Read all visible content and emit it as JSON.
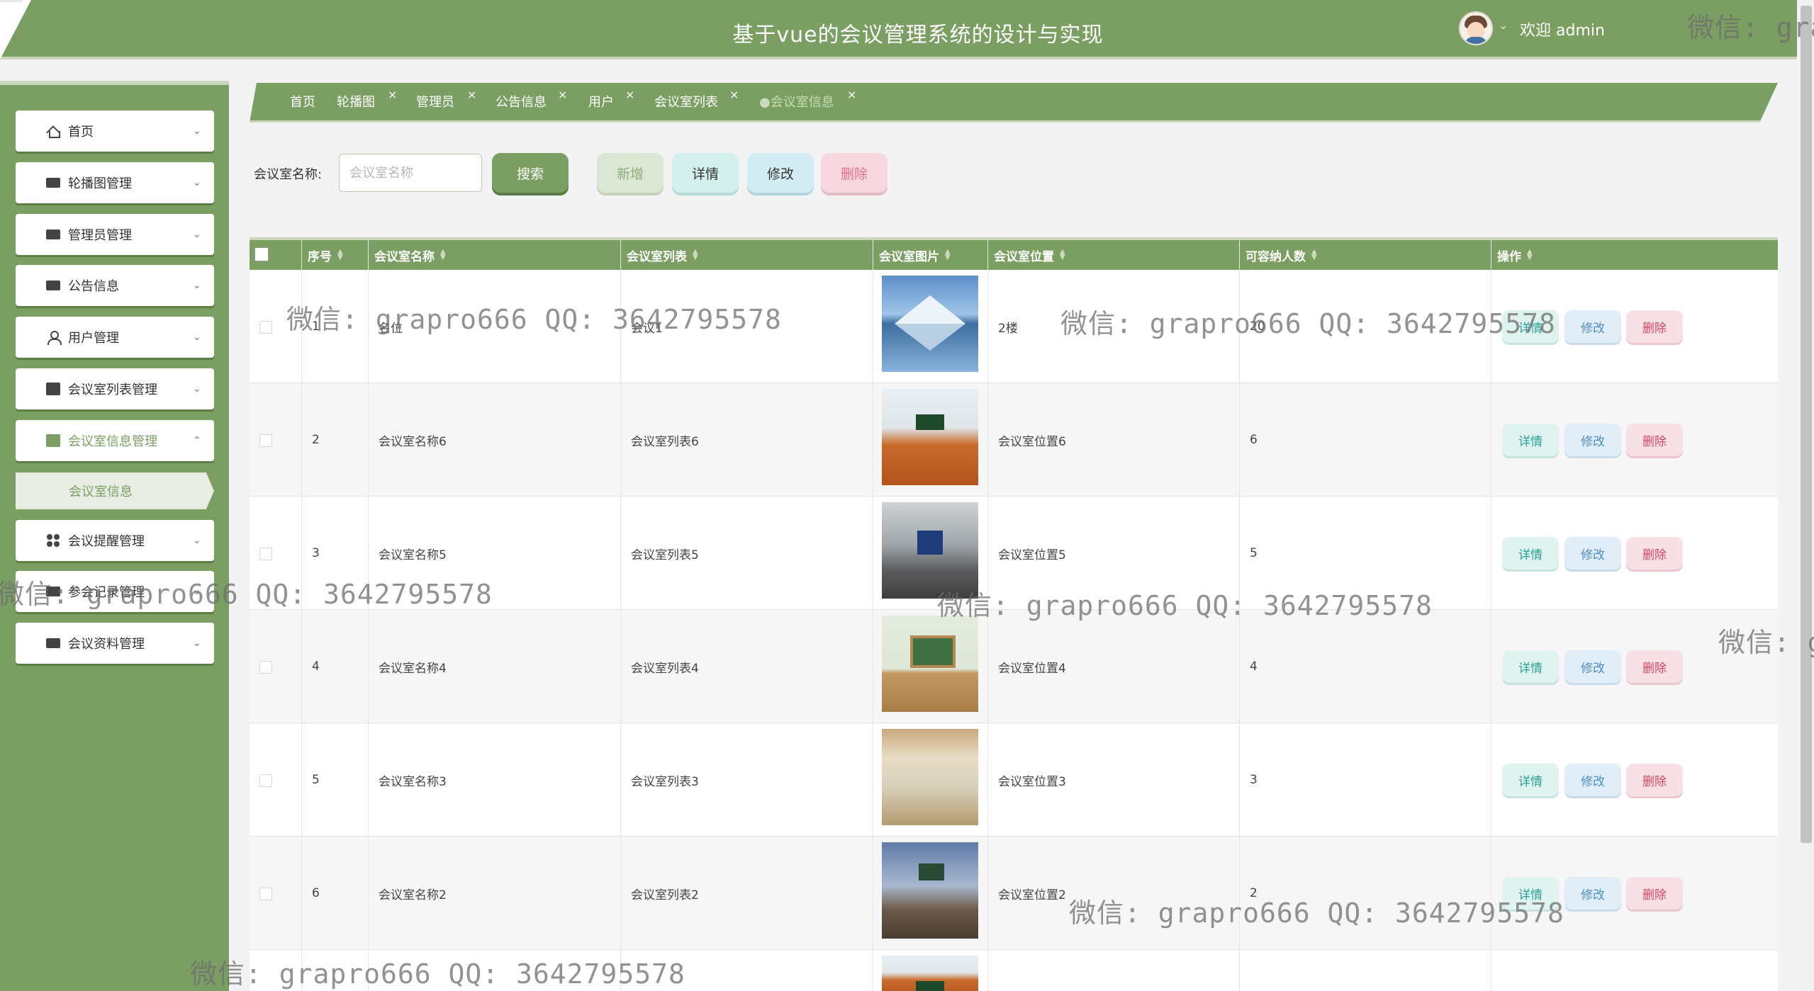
{
  "header": {
    "title": "基于vue的会议管理系统的设计与实现",
    "welcome": "欢迎 admin"
  },
  "sidebar": {
    "items": [
      {
        "label": "首页",
        "icon": "home-icon"
      },
      {
        "label": "轮播图管理",
        "icon": "briefcase-icon"
      },
      {
        "label": "管理员管理",
        "icon": "briefcase-icon"
      },
      {
        "label": "公告信息",
        "icon": "folder-icon"
      },
      {
        "label": "用户管理",
        "icon": "user-icon"
      },
      {
        "label": "会议室列表管理",
        "icon": "box-icon"
      },
      {
        "label": "会议室信息管理",
        "icon": "box-icon"
      },
      {
        "label": "会议提醒管理",
        "icon": "grid-icon"
      },
      {
        "label": "参会记录管理",
        "icon": "folder-icon"
      },
      {
        "label": "会议资料管理",
        "icon": "wallet-icon"
      }
    ],
    "submenu_active": "会议室信息"
  },
  "tabs": [
    {
      "label": "首页",
      "closable": false
    },
    {
      "label": "轮播图",
      "closable": true
    },
    {
      "label": "管理员",
      "closable": true
    },
    {
      "label": "公告信息",
      "closable": true
    },
    {
      "label": "用户",
      "closable": true
    },
    {
      "label": "会议室列表",
      "closable": true
    },
    {
      "label": "●会议室信息",
      "closable": true,
      "active": true
    }
  ],
  "filter": {
    "label": "会议室名称:",
    "placeholder": "会议室名称",
    "search": "搜索",
    "add": "新增",
    "detail": "详情",
    "edit": "修改",
    "delete": "删除"
  },
  "table": {
    "columns": [
      "序号",
      "会议室名称",
      "会议室列表",
      "会议室图片",
      "会议室位置",
      "可容纳人数",
      "操作"
    ],
    "rows": [
      {
        "index": "1",
        "name": "名位",
        "list": "会议1",
        "location": "2楼",
        "capacity": "20",
        "image": "mountain-lake"
      },
      {
        "index": "2",
        "name": "会议室名称6",
        "list": "会议室列表6",
        "location": "会议室位置6",
        "capacity": "6",
        "image": "classroom-orange-seats"
      },
      {
        "index": "3",
        "name": "会议室名称5",
        "list": "会议室列表5",
        "location": "会议室位置5",
        "capacity": "5",
        "image": "classroom-screen"
      },
      {
        "index": "4",
        "name": "会议室名称4",
        "list": "会议室列表4",
        "location": "会议室位置4",
        "capacity": "4",
        "image": "classroom-chalkboard"
      },
      {
        "index": "5",
        "name": "会议室名称3",
        "list": "会议室列表3",
        "location": "会议室位置3",
        "capacity": "3",
        "image": "classroom-wood"
      },
      {
        "index": "6",
        "name": "会议室名称2",
        "list": "会议室列表2",
        "location": "会议室位置2",
        "capacity": "2",
        "image": "classroom-blue"
      }
    ],
    "actions": {
      "detail": "详情",
      "edit": "修改",
      "delete": "删除"
    }
  },
  "watermark": {
    "text": "微信: grapro666 QQ: 3642795578",
    "text_short": "微信: gra"
  },
  "colors": {
    "primary": "#7b9f62",
    "detail": "#2aa198",
    "edit": "#4a90c8",
    "delete": "#d9455f"
  }
}
